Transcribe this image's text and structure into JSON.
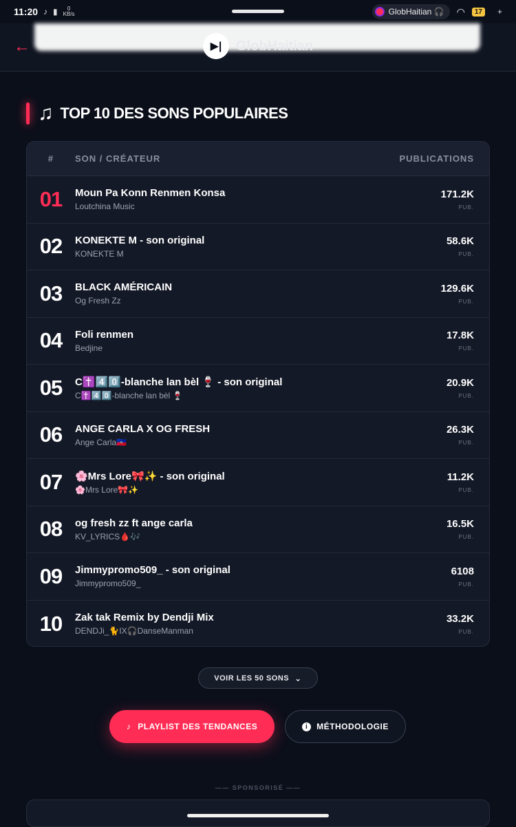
{
  "status_bar": {
    "time": "11:20",
    "net_speed": "0",
    "net_unit": "KB/s",
    "app_chip": "GlobHaitian 🎧",
    "battery": "17"
  },
  "header": {
    "brand": "GlobHaitian",
    "back_icon": "arrow-left-icon"
  },
  "section": {
    "title": "TOP 10 DES SONS POPULAIRES",
    "icon": "music-note-icon"
  },
  "table": {
    "col_num": "#",
    "col_song": "SON / CRÉATEUR",
    "col_pub": "PUBLICATIONS",
    "pub_unit": "PUB.",
    "rows": [
      {
        "rank": "01",
        "title": "Moun Pa Konn Renmen Konsa",
        "creator": "Loutchina Music",
        "count": "171.2K"
      },
      {
        "rank": "02",
        "title": "KONEKTE M - son original",
        "creator": "KONEKTE M",
        "count": "58.6K"
      },
      {
        "rank": "03",
        "title": "BLACK AMÉRICAIN",
        "creator": "Og Fresh Zz",
        "count": "129.6K"
      },
      {
        "rank": "04",
        "title": "Foli renmen",
        "creator": "Bedjine",
        "count": "17.8K"
      },
      {
        "rank": "05",
        "title": "C✝️4️⃣0️⃣-blanche lan bèl 🍷 - son original",
        "creator": "C✝️4️⃣0️⃣-blanche lan bèl 🍷",
        "count": "20.9K"
      },
      {
        "rank": "06",
        "title": "ANGE CARLA X OG FRESH",
        "creator": "Ange Carla🇭🇹",
        "count": "26.3K"
      },
      {
        "rank": "07",
        "title": "🌸Mrs Lore🎀✨ - son original",
        "creator": "🌸Mrs Lore🎀✨",
        "count": "11.2K"
      },
      {
        "rank": "08",
        "title": "og fresh zz ft ange carla",
        "creator": "KV_LYRICS🩸🎶",
        "count": "16.5K"
      },
      {
        "rank": "09",
        "title": "Jimmypromo509_ - son original",
        "creator": "Jimmypromo509_",
        "count": "6108"
      },
      {
        "rank": "10",
        "title": "Zak tak Remix by Dendji Mix",
        "creator": "DENDJi_🐈IX🎧DanseManman",
        "count": "33.2K"
      }
    ]
  },
  "buttons": {
    "more": "VOIR LES 50 SONS",
    "playlist": "PLAYLIST DES TENDANCES",
    "methodology": "MÉTHODOLOGIE"
  },
  "sponsor_label": "—— SPONSORISÉ ——",
  "colors": {
    "accent": "#ff2d55",
    "background": "#0b0f1a",
    "card": "#141927"
  }
}
